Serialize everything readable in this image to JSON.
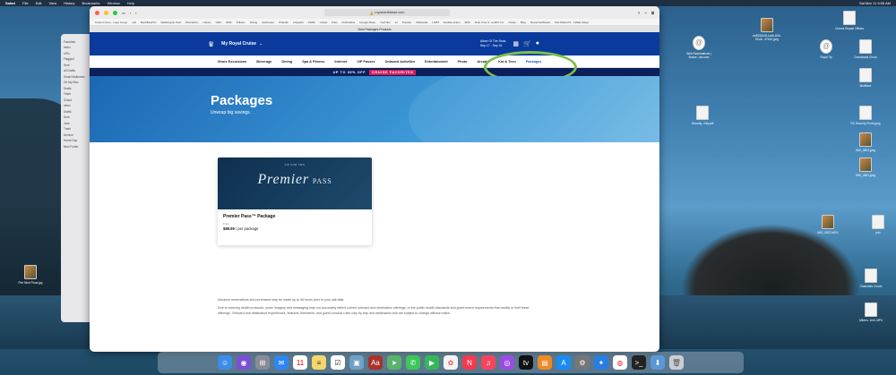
{
  "menubar": {
    "app": "Safari",
    "items": [
      "File",
      "Edit",
      "View",
      "History",
      "Bookmarks",
      "Window",
      "Help"
    ],
    "clock": "Sat Mar 11  9:55 AM"
  },
  "browser": {
    "url": "royalcaribbean.com",
    "tab_title": "View Packages Products",
    "bookmarks": [
      "Custom Grou...Logo Group",
      "null",
      "BookBookTiv",
      "Washington Post",
      "Wunderfox",
      "Library",
      "ORC",
      "ESR",
      "Trillions",
      "Giving",
      "Upshooter",
      "Pinterlin",
      "craigslist",
      "ASPE",
      "United",
      "Files",
      "ProPublica",
      "Google Maps",
      "YouTube",
      "sn",
      "Popular",
      "Wikipedia",
      "LGBT",
      "Double Action",
      "BOS",
      "Rule Over #...andhiz Inc",
      "Chase",
      "Blog",
      "Royal Caribbean",
      "MH Offer/of 6...I Made Easy!"
    ]
  },
  "site": {
    "my_account": "My Royal Cruise",
    "ship_line1": "Allure Of The Seas",
    "ship_line2": "Sep 17 - Sep 24",
    "nav": [
      "Shore Excursions",
      "Beverage",
      "Dining",
      "Spa & Fitness",
      "Internet",
      "VIP Passes",
      "Onboard Activities",
      "Entertainment",
      "Photo",
      "Arcade",
      "Kid & Teen",
      "Packages"
    ],
    "promo_text": "UP TO 35% OFF",
    "promo_tag": "CRUISE FAVORITES",
    "hero_title": "Packages",
    "hero_sub": "Unwrap big savings.",
    "card": {
      "eyebrow": "VIP FOR TWO",
      "brand_script": "Premier",
      "brand_caps": "PASS",
      "name": "Premier Pass™ Package",
      "from": "From",
      "price": "$88.99",
      "price_unit": "/ per package"
    },
    "disclaimer_1": "Advance reservations and purchases may be made up to 48 hours prior to your sail date.",
    "disclaimer_2": "Due to evolving health protocols, some imagery and messaging may not accurately reflect current onboard and destination offerings, or the public health standards and government requirements that modify or limit these offerings. Onboard and destination experiences, features, itineraries, and guest conduct rules vary by ship and destination and are subject to change without notice."
  },
  "mail_sidebar": [
    "Favorites",
    "Inbox",
    "VIPs",
    "Flagged",
    "Sent",
    "All Drafts",
    "Smart Mailboxes",
    "On My Mac",
    "Drafts",
    "Trash",
    "iCloud",
    "Inbox",
    "Drafts",
    "Sent",
    "Junk",
    "Trash",
    "Archive",
    "Home Dep",
    "New Folder"
  ],
  "desktop_icons": [
    {
      "label": "Pier Nine Pizza.jpg",
      "kind": "photo"
    },
    {
      "label": "Web Reservations | Booke...ise.com",
      "kind": "at"
    },
    {
      "label": "cb8532d28-1cb6-4f1b-8Ca5...37b32.jpeg",
      "kind": "photo"
    },
    {
      "label": "Cornes Royale Offices",
      "kind": "doc"
    },
    {
      "label": "Royal Tip",
      "kind": "at"
    },
    {
      "label": "Downloads Cloud",
      "kind": "doc"
    },
    {
      "label": "Multiface",
      "kind": "doc"
    },
    {
      "label": "Security...ivity.pdf",
      "kind": "doc"
    },
    {
      "label": "RC Security Photo.jpeg",
      "kind": "doc"
    },
    {
      "label": "IMG_0803.jpeg",
      "kind": "photo"
    },
    {
      "label": "IMG_0681.jpeg",
      "kind": "photo"
    },
    {
      "label": "IMG_0822.MOV",
      "kind": "photo"
    },
    {
      "label": "pdx",
      "kind": "doc"
    },
    {
      "label": "Charlottes Condo",
      "kind": "doc"
    },
    {
      "label": "Mileen...tent .MP4",
      "kind": "doc"
    }
  ],
  "dock_apps": [
    "Finder",
    "Siri",
    "Launchpad",
    "Mail",
    "Calendar",
    "Notes",
    "Reminders",
    "Preview",
    "Dictionary",
    "Maps",
    "Messages",
    "FaceTime",
    "Photos",
    "News",
    "Music",
    "Podcasts",
    "TV",
    "Books",
    "App Store",
    "System Settings",
    "Safari",
    "Chrome",
    "Terminal",
    "Downloads",
    "Trash"
  ]
}
